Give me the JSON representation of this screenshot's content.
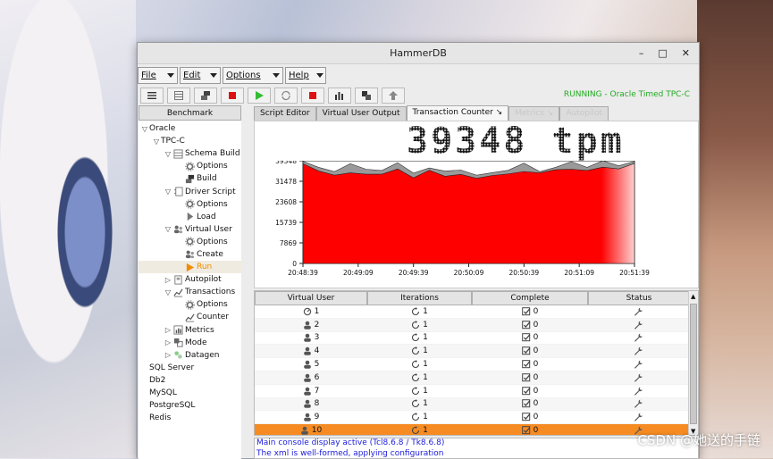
{
  "window": {
    "title": "HammerDB",
    "controls": [
      "–",
      "□",
      "✕"
    ]
  },
  "menus": [
    {
      "label": "File"
    },
    {
      "label": "Edit"
    },
    {
      "label": "Options"
    },
    {
      "label": "Help"
    }
  ],
  "toolbar": {
    "buttons": [
      "menu-icon",
      "grid-icon",
      "build-icon",
      "stop-icon",
      "run-icon",
      "loop-icon",
      "stop-icon",
      "chart-icon",
      "stack-icon",
      "upload-icon"
    ],
    "status": "RUNNING - Oracle Timed TPC-C",
    "status_color": "#22aa22"
  },
  "sidebar": {
    "tab_label": "Benchmark",
    "tree": [
      {
        "label": "Oracle",
        "indent": 0,
        "exp": "▽",
        "icon": ""
      },
      {
        "label": "TPC-C",
        "indent": 1,
        "exp": "▽",
        "icon": ""
      },
      {
        "label": "Schema Build",
        "indent": 2,
        "exp": "▽",
        "icon": "schema"
      },
      {
        "label": "Options",
        "indent": 3,
        "exp": "",
        "icon": "gear"
      },
      {
        "label": "Build",
        "indent": 3,
        "exp": "",
        "icon": "build"
      },
      {
        "label": "Driver Script",
        "indent": 2,
        "exp": "▽",
        "icon": "driver"
      },
      {
        "label": "Options",
        "indent": 3,
        "exp": "",
        "icon": "gear"
      },
      {
        "label": "Load",
        "indent": 3,
        "exp": "",
        "icon": "load"
      },
      {
        "label": "Virtual User",
        "indent": 2,
        "exp": "▽",
        "icon": "users"
      },
      {
        "label": "Options",
        "indent": 3,
        "exp": "",
        "icon": "gear"
      },
      {
        "label": "Create",
        "indent": 3,
        "exp": "",
        "icon": "users"
      },
      {
        "label": "Run",
        "indent": 3,
        "exp": "",
        "icon": "run",
        "selected": true
      },
      {
        "label": "Autopilot",
        "indent": 2,
        "exp": "▷",
        "icon": "autopilot"
      },
      {
        "label": "Transactions",
        "indent": 2,
        "exp": "▽",
        "icon": "chart"
      },
      {
        "label": "Options",
        "indent": 3,
        "exp": "",
        "icon": "gear"
      },
      {
        "label": "Counter",
        "indent": 3,
        "exp": "",
        "icon": "chart"
      },
      {
        "label": "Metrics",
        "indent": 2,
        "exp": "▷",
        "icon": "metrics"
      },
      {
        "label": "Mode",
        "indent": 2,
        "exp": "▷",
        "icon": "mode"
      },
      {
        "label": "Datagen",
        "indent": 2,
        "exp": "▷",
        "icon": "datagen"
      },
      {
        "label": "SQL Server",
        "indent": 0,
        "exp": "",
        "icon": ""
      },
      {
        "label": "Db2",
        "indent": 0,
        "exp": "",
        "icon": ""
      },
      {
        "label": "MySQL",
        "indent": 0,
        "exp": "",
        "icon": ""
      },
      {
        "label": "PostgreSQL",
        "indent": 0,
        "exp": "",
        "icon": ""
      },
      {
        "label": "Redis",
        "indent": 0,
        "exp": "",
        "icon": ""
      }
    ]
  },
  "tabs": [
    {
      "label": "Script Editor",
      "state": "normal"
    },
    {
      "label": "Virtual User Output",
      "state": "normal"
    },
    {
      "label": "Transaction Counter ↘",
      "state": "active"
    },
    {
      "label": "Metrics ↘",
      "state": "disabled"
    },
    {
      "label": "Autopilot",
      "state": "disabled"
    }
  ],
  "counter": {
    "value": "39348",
    "unit": "tpm"
  },
  "chart_data": {
    "type": "area",
    "title": "",
    "x": [
      "20:48:39",
      "20:49:09",
      "20:49:39",
      "20:50:09",
      "20:50:39",
      "20:51:09",
      "20:51:39"
    ],
    "yticks": [
      39348,
      31478,
      23608,
      15739,
      7869,
      0
    ],
    "ylim": [
      0,
      39348
    ],
    "series": [
      {
        "values": [
          39100,
          36800,
          35200,
          38200,
          36100,
          35600,
          38600,
          34600,
          36600,
          35400,
          35800,
          33800,
          34800,
          35700,
          38400,
          35200,
          36800,
          39000,
          36800,
          39348,
          37400,
          39100
        ]
      },
      {
        "values": [
          38200,
          35400,
          33800,
          34700,
          34200,
          34200,
          36200,
          32800,
          35700,
          33400,
          34100,
          32600,
          33700,
          34300,
          35200,
          34700,
          35900,
          36100,
          35600,
          36900,
          36200,
          38300
        ]
      }
    ],
    "fill_color": "#ff0000",
    "shadow_color": "#9a9a9a",
    "grid": false
  },
  "table": {
    "columns": [
      "Virtual User",
      "Iterations",
      "Complete",
      "Status"
    ],
    "rows": [
      {
        "user": "1",
        "iter": "1",
        "complete": "0",
        "monitor": true
      },
      {
        "user": "2",
        "iter": "1",
        "complete": "0"
      },
      {
        "user": "3",
        "iter": "1",
        "complete": "0"
      },
      {
        "user": "4",
        "iter": "1",
        "complete": "0"
      },
      {
        "user": "5",
        "iter": "1",
        "complete": "0"
      },
      {
        "user": "6",
        "iter": "1",
        "complete": "0"
      },
      {
        "user": "7",
        "iter": "1",
        "complete": "0"
      },
      {
        "user": "8",
        "iter": "1",
        "complete": "0"
      },
      {
        "user": "9",
        "iter": "1",
        "complete": "0"
      },
      {
        "user": "10",
        "iter": "1",
        "complete": "0",
        "selected": true
      }
    ]
  },
  "console": {
    "lines": [
      "Main console display active (Tcl8.6.8 / Tk8.6.8)",
      "The xml is well-formed, applying configuration"
    ]
  },
  "watermark": "CSDN @她送的手链"
}
